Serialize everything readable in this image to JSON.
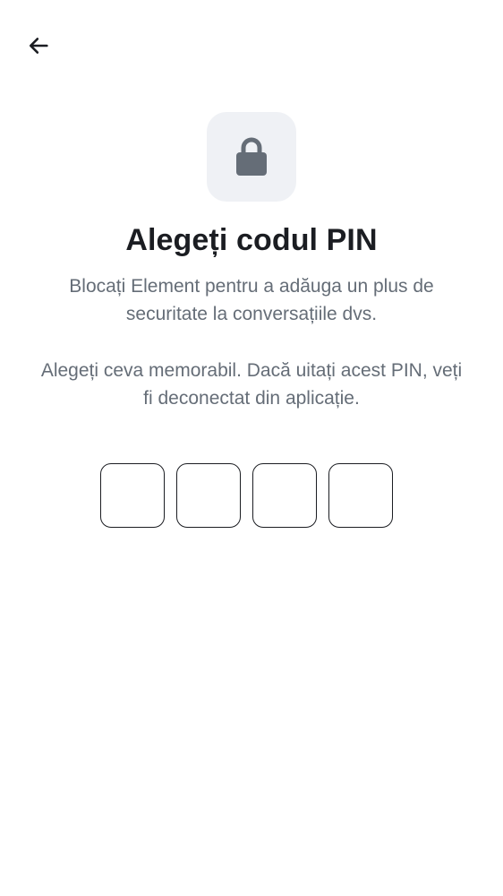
{
  "header": {
    "back_icon": "arrow-left-icon"
  },
  "hero": {
    "icon": "lock-icon",
    "icon_color": "#656d77",
    "tile_color": "#eff1f5"
  },
  "title": "Alegeți codul PIN",
  "description": [
    "Blocați Element pentru a adăuga un plus de securitate la conversațiile dvs.",
    "Alegeți ceva memorabil. Dacă uitați acest PIN, veți fi deconectat din aplicație."
  ],
  "pin": {
    "length": 4,
    "digits": [
      "",
      "",
      "",
      ""
    ]
  }
}
